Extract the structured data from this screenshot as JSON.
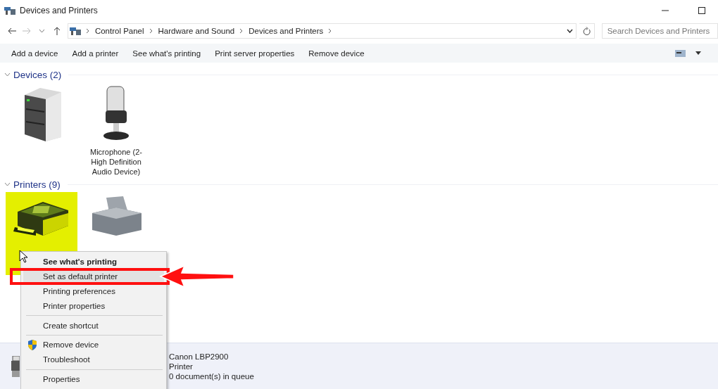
{
  "window": {
    "title": "Devices and Printers"
  },
  "address": {
    "breadcrumbs": [
      "Control Panel",
      "Hardware and Sound",
      "Devices and Printers"
    ]
  },
  "search": {
    "placeholder": "Search Devices and Printers"
  },
  "commands": [
    "Add a device",
    "Add a printer",
    "See what's printing",
    "Print server properties",
    "Remove device"
  ],
  "groups": [
    {
      "title": "Devices (2)",
      "expanded": true,
      "items": [
        {
          "kind": "computer",
          "selected": false
        },
        {
          "kind": "microphone",
          "label": "Microphone (2- High Definition Audio Device)",
          "selected": false
        }
      ]
    },
    {
      "title": "Printers (9)",
      "expanded": true,
      "items": [
        {
          "kind": "printer",
          "selected": true
        },
        {
          "kind": "printer-large",
          "selected": false
        }
      ]
    }
  ],
  "context_menu": {
    "items": [
      {
        "kind": "item",
        "label": "See what's printing",
        "default": true,
        "highlighted": false
      },
      {
        "kind": "item",
        "label": "Set as default printer",
        "default": false,
        "highlighted": true
      },
      {
        "kind": "item",
        "label": "Printing preferences",
        "default": false,
        "highlighted": false
      },
      {
        "kind": "item",
        "label": "Printer properties",
        "default": false,
        "highlighted": false
      },
      {
        "kind": "separator"
      },
      {
        "kind": "item",
        "label": "Create shortcut",
        "default": false,
        "highlighted": false
      },
      {
        "kind": "separator"
      },
      {
        "kind": "admin",
        "label": "Remove device",
        "default": false,
        "highlighted": false
      },
      {
        "kind": "item",
        "label": "Troubleshoot",
        "default": false,
        "highlighted": false
      },
      {
        "kind": "separator"
      },
      {
        "kind": "item",
        "label": "Properties",
        "default": false,
        "highlighted": false
      }
    ]
  },
  "details": {
    "lines": [
      "Canon LBP2900",
      "Printer",
      "0 document(s) in queue"
    ]
  }
}
